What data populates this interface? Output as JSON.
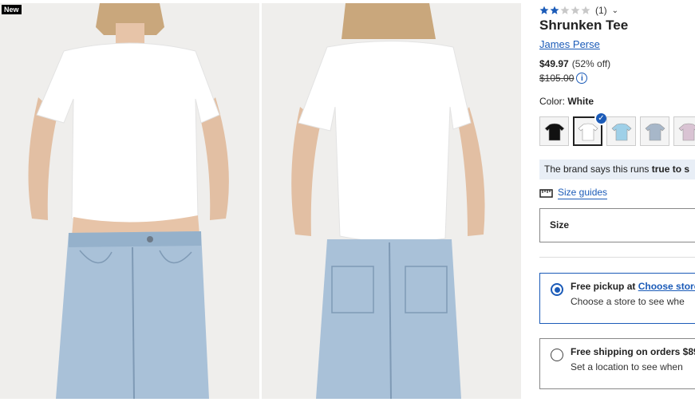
{
  "gallery": {
    "badge": "New",
    "photos": [
      "front-view",
      "back-view"
    ]
  },
  "product": {
    "rating_value": 2,
    "rating_max": 5,
    "rating_count": "(1)",
    "title": "Shrunken Tee",
    "brand": "James Perse",
    "price_now": "$49.97",
    "price_off": "(52% off)",
    "price_was": "$105.00"
  },
  "color": {
    "label": "Color:",
    "selected": "White",
    "swatches": [
      {
        "name": "black",
        "hex": "#111111"
      },
      {
        "name": "white",
        "hex": "#ffffff",
        "selected": true
      },
      {
        "name": "light-blue",
        "hex": "#9fd0e8"
      },
      {
        "name": "blue-gray",
        "hex": "#a7b7c9"
      },
      {
        "name": "lilac",
        "hex": "#d9c3d3"
      }
    ]
  },
  "fit": {
    "prefix": "The brand says this runs ",
    "bold": "true to s"
  },
  "size_guides": {
    "label": "Size guides"
  },
  "size_select": {
    "label": "Size"
  },
  "fulfillment": {
    "pickup_title": "Free pickup at ",
    "pickup_link": "Choose store",
    "pickup_sub": "Choose a store to see whe",
    "shipping_title": "Free shipping on orders $89",
    "shipping_sub": "Set a location to see when"
  },
  "colors": {
    "accent": "#1b5bb8",
    "star_filled": "#1b5bb8",
    "star_empty": "#c8c8c8",
    "banner_bg": "#e8eef6"
  }
}
